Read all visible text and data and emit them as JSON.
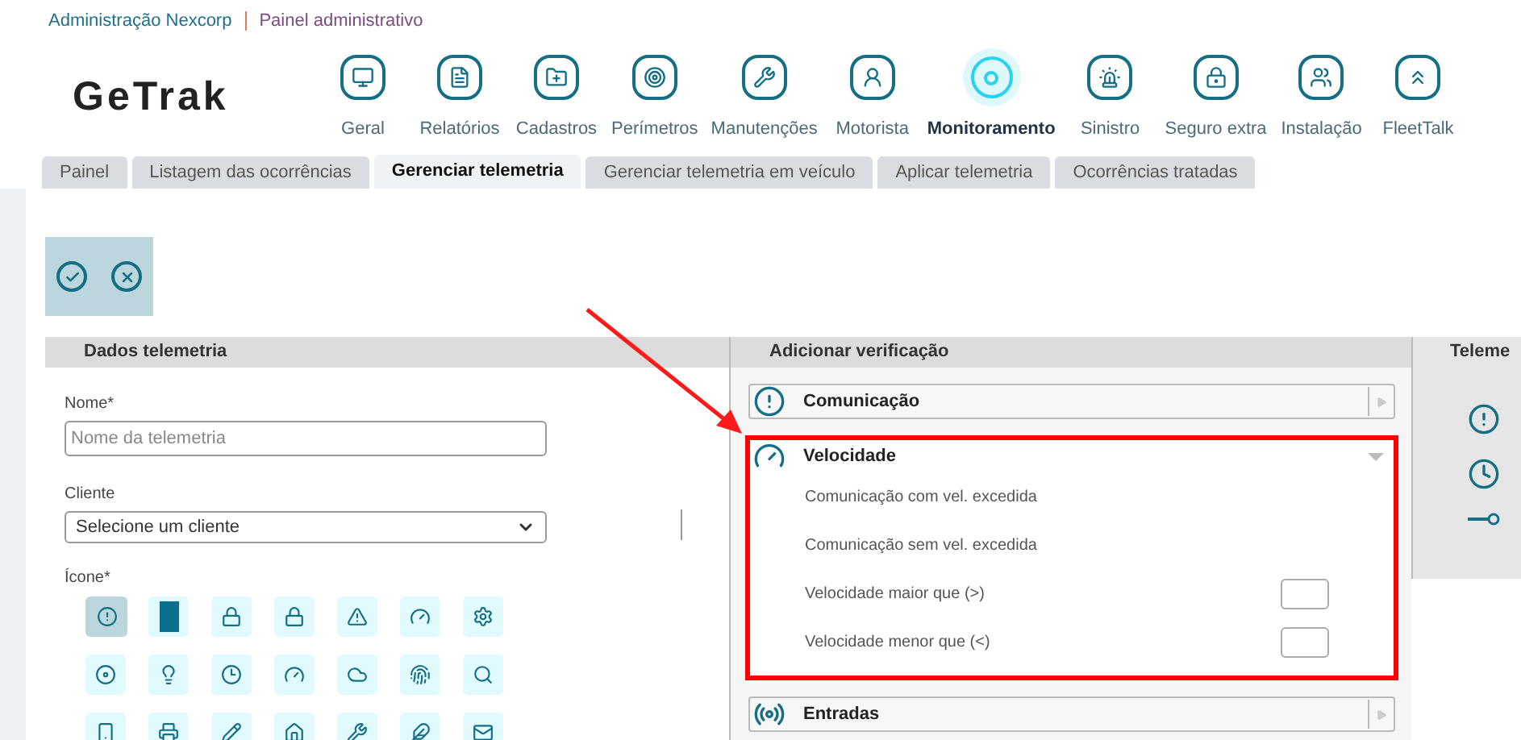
{
  "breadcrumb": {
    "company": "Administração Nexcorp",
    "page": "Painel administrativo"
  },
  "logo": "GeTrak",
  "nav": [
    {
      "label": "Geral",
      "selected": false
    },
    {
      "label": "Relatórios",
      "selected": false
    },
    {
      "label": "Cadastros",
      "selected": false
    },
    {
      "label": "Perímetros",
      "selected": false
    },
    {
      "label": "Manutenções",
      "selected": false
    },
    {
      "label": "Motorista",
      "selected": false
    },
    {
      "label": "Monitoramento",
      "selected": true
    },
    {
      "label": "Sinistro",
      "selected": false
    },
    {
      "label": "Seguro extra",
      "selected": false
    },
    {
      "label": "Instalação",
      "selected": false
    },
    {
      "label": "FleetTalk",
      "selected": false
    }
  ],
  "tabs": [
    {
      "label": "Painel",
      "selected": false
    },
    {
      "label": "Listagem das ocorrências",
      "selected": false
    },
    {
      "label": "Gerenciar telemetria",
      "selected": true
    },
    {
      "label": "Gerenciar telemetria em veículo",
      "selected": false
    },
    {
      "label": "Aplicar telemetria",
      "selected": false
    },
    {
      "label": "Ocorrências tratadas",
      "selected": false
    }
  ],
  "left_panel": {
    "title": "Dados telemetria",
    "name_label": "Nome*",
    "name_placeholder": "Nome da telemetria",
    "client_label": "Cliente",
    "client_value": "Selecione um cliente",
    "icon_label": "Ícone*",
    "icons": [
      {
        "selected": true,
        "highlighted": false
      },
      {
        "selected": false,
        "highlighted": true
      },
      {
        "selected": false,
        "highlighted": false
      },
      {
        "selected": false,
        "highlighted": false
      },
      {
        "selected": false,
        "highlighted": false
      },
      {
        "selected": false,
        "highlighted": false
      },
      {
        "selected": false,
        "highlighted": false
      },
      {
        "selected": false,
        "highlighted": false
      },
      {
        "selected": false,
        "highlighted": false
      },
      {
        "selected": false,
        "highlighted": false
      },
      {
        "selected": false,
        "highlighted": false
      },
      {
        "selected": false,
        "highlighted": false
      },
      {
        "selected": false,
        "highlighted": false
      },
      {
        "selected": false,
        "highlighted": false
      },
      {
        "selected": false,
        "highlighted": false
      },
      {
        "selected": false,
        "highlighted": false
      },
      {
        "selected": false,
        "highlighted": false
      },
      {
        "selected": false,
        "highlighted": false
      },
      {
        "selected": false,
        "highlighted": false
      },
      {
        "selected": false,
        "highlighted": false
      },
      {
        "selected": false,
        "highlighted": false
      }
    ]
  },
  "middle_panel": {
    "title": "Adicionar verificação",
    "sections": [
      {
        "title": "Comunicação",
        "expanded": false,
        "highlighted": false
      },
      {
        "title": "Velocidade",
        "expanded": true,
        "highlighted": true,
        "rows": [
          {
            "label": "Comunicação com vel. excedida",
            "kind": "option"
          },
          {
            "label": "Comunicação sem vel. excedida",
            "kind": "option"
          },
          {
            "label": "Velocidade maior que (>)",
            "kind": "input"
          },
          {
            "label": "Velocidade menor que (<)",
            "kind": "input"
          }
        ]
      },
      {
        "title": "Entradas",
        "expanded": false,
        "highlighted": false
      }
    ]
  },
  "right_panel": {
    "title": "Teleme"
  }
}
